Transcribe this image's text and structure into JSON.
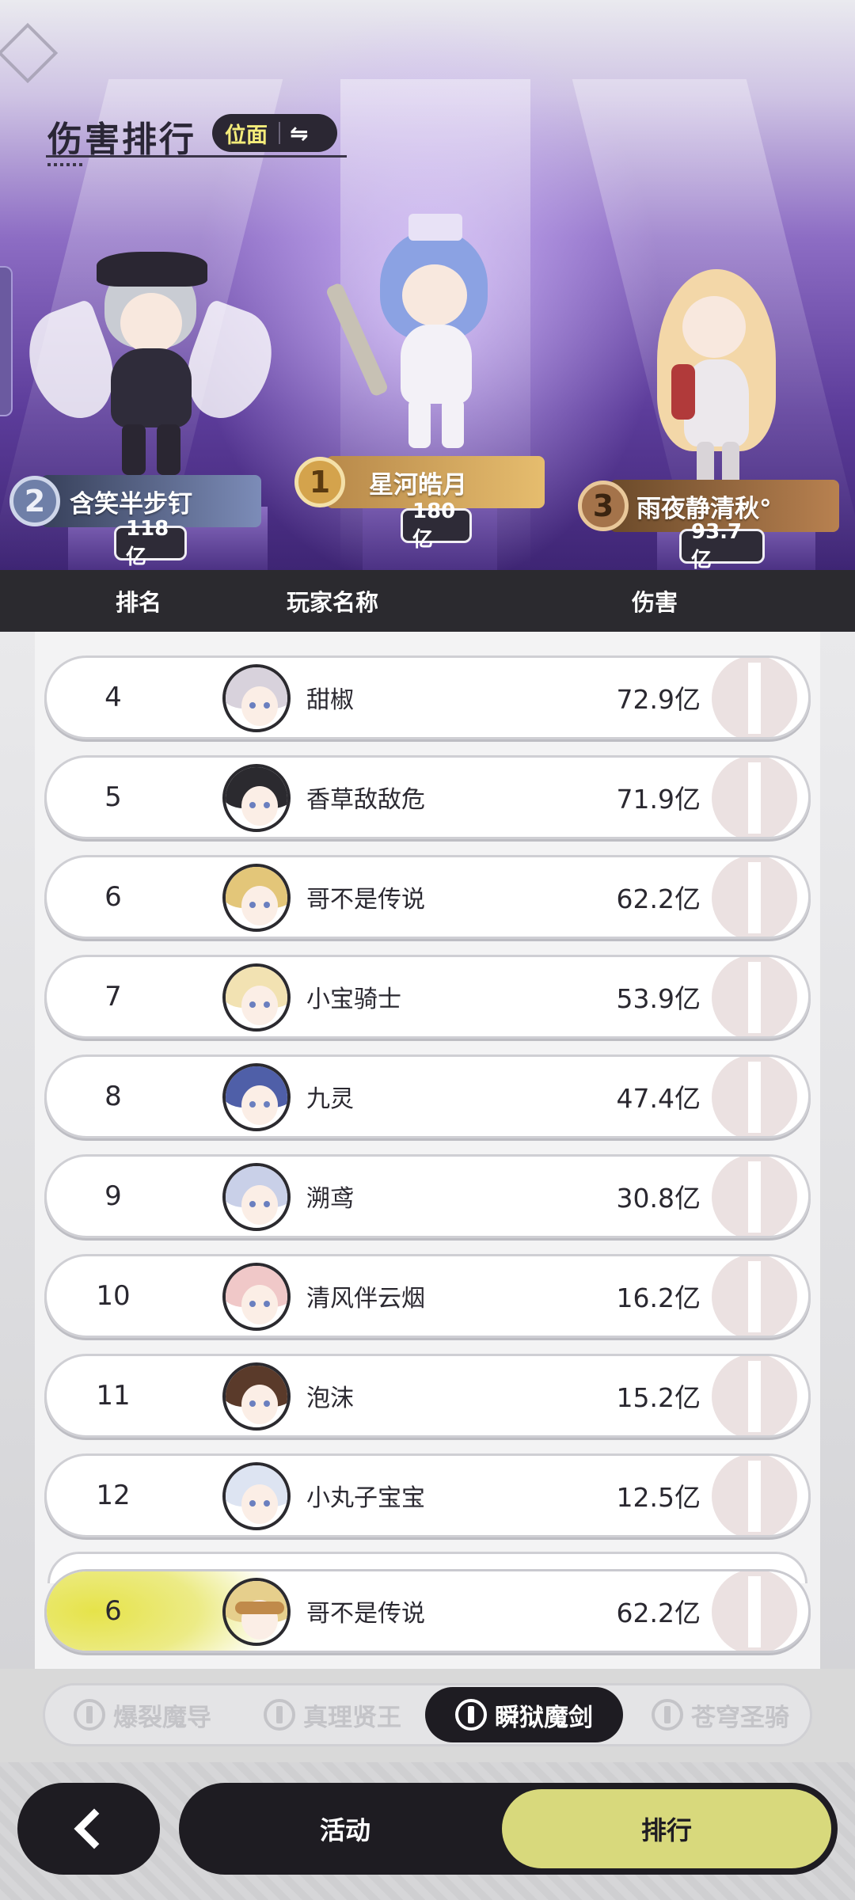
{
  "header": {
    "title": "伤害排行",
    "mode_label": "位面",
    "mode_swap_icon": "⇋"
  },
  "podium": [
    {
      "rank": "2",
      "name": "含笑半步钉",
      "damage": "118亿"
    },
    {
      "rank": "1",
      "name": "星河皓月",
      "damage": "180亿"
    },
    {
      "rank": "3",
      "name": "雨夜静清秋°",
      "damage": "93.7亿"
    }
  ],
  "table": {
    "columns": [
      "排名",
      "玩家名称",
      "伤害"
    ],
    "rows": [
      {
        "rank": "4",
        "name": "甜椒",
        "damage": "72.9亿"
      },
      {
        "rank": "5",
        "name": "香草敌敌危",
        "damage": "71.9亿"
      },
      {
        "rank": "6",
        "name": "哥不是传说",
        "damage": "62.2亿"
      },
      {
        "rank": "7",
        "name": "小宝骑士",
        "damage": "53.9亿"
      },
      {
        "rank": "8",
        "name": "九灵",
        "damage": "47.4亿"
      },
      {
        "rank": "9",
        "name": "溯鸢",
        "damage": "30.8亿"
      },
      {
        "rank": "10",
        "name": "清风伴云烟",
        "damage": "16.2亿"
      },
      {
        "rank": "11",
        "name": "泡沫",
        "damage": "15.2亿"
      },
      {
        "rank": "12",
        "name": "小丸子宝宝",
        "damage": "12.5亿"
      }
    ],
    "my_row": {
      "rank": "6",
      "name": "哥不是传说",
      "damage": "62.2亿"
    }
  },
  "class_tabs": [
    {
      "label": "爆裂魔导",
      "active": false
    },
    {
      "label": "真理贤王",
      "active": false
    },
    {
      "label": "瞬狱魔剑",
      "active": true
    },
    {
      "label": "苍穹圣骑",
      "active": false
    }
  ],
  "bottom_nav": {
    "back_icon": "chevron-left-icon",
    "activity_label": "活动",
    "ranking_label": "排行"
  },
  "colors": {
    "accent_yellow": "#d8d97c",
    "dark": "#1e1c22",
    "header_purple": "#5c3c9a"
  }
}
